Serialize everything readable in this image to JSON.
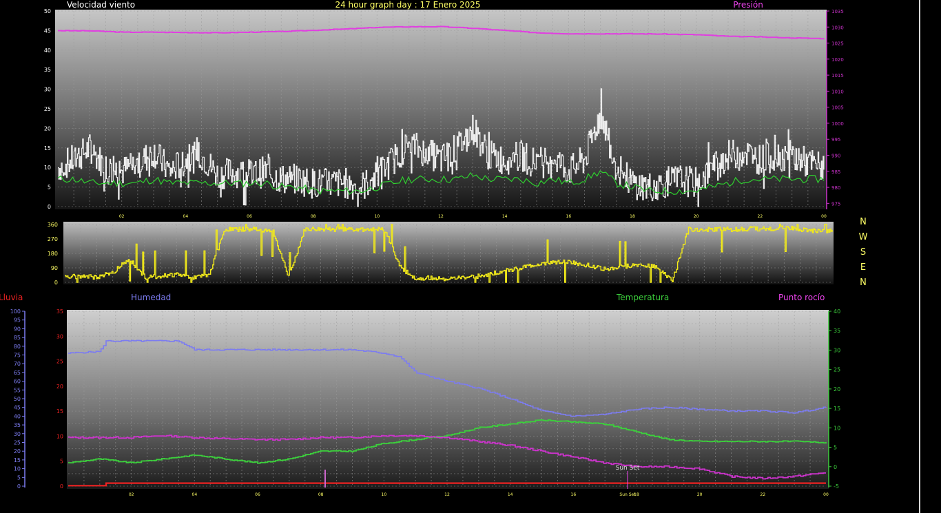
{
  "header": {
    "wind_title": "Velocidad viento",
    "graph_title": "24 hour graph day : 17 Enero 2025",
    "pressure_title": "Presión"
  },
  "compass": [
    "N",
    "W",
    "S",
    "E",
    "N"
  ],
  "legend": {
    "rain": "Lluvia",
    "humidity": "Humedad",
    "temperature": "Temperatura",
    "dewpoint": "Punto rocío"
  },
  "annotations": {
    "sunset": "Sun Set",
    "sunset_tick": "Sun Set"
  },
  "colors": {
    "wind_gust": "#ededed",
    "wind_avg": "#cfe8cf",
    "wind_green": "#2fcf2f",
    "pressure": "#e040e0",
    "direction": "#f2ea1a",
    "humidity": "#7c7cf0",
    "temperature": "#3ccf3c",
    "dewpoint": "#cc33cc",
    "rain": "#ee2222",
    "wind_axis": "#ffffff",
    "pressure_axis": "#cc33cc",
    "tick_label": "#ffff66"
  },
  "chart_data": [
    {
      "type": "line",
      "panel": "wind_pressure",
      "x_ticks": [
        "02",
        "04",
        "06",
        "08",
        "10",
        "12",
        "14",
        "16",
        "18",
        "20",
        "22",
        "00"
      ],
      "y_left": {
        "ticks": [
          0,
          5,
          10,
          15,
          20,
          25,
          30,
          35,
          40,
          45,
          50
        ],
        "ylim": [
          0,
          50
        ]
      },
      "y_right": {
        "ticks": [
          975,
          980,
          985,
          990,
          995,
          1000,
          1005,
          1010,
          1015,
          1020,
          1025,
          1030,
          1035
        ],
        "ylim": [
          974,
          1035
        ]
      },
      "grid": true,
      "series": [
        {
          "key": "gust",
          "hours": [
            0,
            0.5,
            1,
            1.5,
            2,
            2.5,
            3,
            3.5,
            4,
            4.5,
            5,
            5.5,
            6,
            6.5,
            7,
            7.5,
            8,
            8.5,
            9,
            9.5,
            10,
            10.5,
            11,
            11.5,
            12,
            12.5,
            13,
            13.5,
            14,
            14.5,
            15,
            15.5,
            16,
            16.5,
            17,
            17.5,
            18,
            18.5,
            19,
            19.5,
            20,
            20.5,
            21,
            21.5,
            22,
            22.5,
            23,
            23.5,
            24
          ],
          "values": [
            10,
            12,
            15,
            10,
            9,
            11,
            14,
            9,
            12,
            13,
            8,
            9,
            8,
            9,
            7,
            7,
            6,
            6,
            6,
            5,
            8,
            12,
            16,
            14,
            12,
            15,
            20,
            13,
            12,
            13,
            11,
            13,
            9,
            12,
            24,
            10,
            6,
            5,
            6,
            7,
            6,
            10,
            13,
            14,
            12,
            13,
            13,
            11,
            10
          ]
        },
        {
          "key": "avg",
          "hours": [
            0,
            0.5,
            1,
            1.5,
            2,
            2.5,
            3,
            3.5,
            4,
            4.5,
            5,
            5.5,
            6,
            6.5,
            7,
            7.5,
            8,
            8.5,
            9,
            9.5,
            10,
            10.5,
            11,
            11.5,
            12,
            12.5,
            13,
            13.5,
            14,
            14.5,
            15,
            15.5,
            16,
            16.5,
            17,
            17.5,
            18,
            18.5,
            19,
            19.5,
            20,
            20.5,
            21,
            21.5,
            22,
            22.5,
            23,
            23.5,
            24
          ],
          "values": [
            7,
            7,
            6,
            6,
            6,
            6,
            7,
            6,
            6,
            6,
            6,
            6,
            6,
            6,
            5,
            5,
            4,
            4,
            4,
            4,
            5,
            6,
            7,
            7,
            7,
            7,
            8,
            7,
            7,
            7,
            6,
            7,
            6,
            7,
            9,
            6,
            5,
            4,
            4,
            4,
            4,
            5,
            6,
            7,
            7,
            7,
            7,
            7,
            7
          ]
        },
        {
          "key": "pressure",
          "hours": [
            0,
            1,
            2,
            3,
            4,
            5,
            6,
            7,
            8,
            9,
            10,
            11,
            12,
            13,
            14,
            15,
            16,
            17,
            18,
            19,
            20,
            21,
            22,
            23,
            24
          ],
          "values": [
            1028.9,
            1028.8,
            1028.4,
            1028.4,
            1028.3,
            1028.2,
            1028.4,
            1028.6,
            1029,
            1029.4,
            1029.9,
            1030.1,
            1030.1,
            1029.6,
            1028.9,
            1028.2,
            1027.9,
            1027.9,
            1027.9,
            1027.8,
            1027.6,
            1027.1,
            1026.9,
            1026.6,
            1026.4
          ]
        }
      ]
    },
    {
      "type": "line",
      "panel": "wind_direction",
      "y": {
        "ticks": [
          0,
          90,
          180,
          270,
          360
        ],
        "ylim": [
          0,
          360
        ]
      },
      "series": [
        {
          "key": "direction",
          "hours": [
            0,
            0.5,
            1,
            1.5,
            2,
            2.5,
            3,
            3.5,
            4,
            4.5,
            5,
            5.5,
            6,
            6.5,
            7,
            7.5,
            8,
            8.5,
            9,
            9.5,
            10,
            10.5,
            11,
            11.5,
            12,
            12.5,
            13,
            13.5,
            14,
            14.5,
            15,
            15.5,
            16,
            16.5,
            17,
            17.5,
            18,
            18.5,
            19,
            19.5,
            20,
            20.5,
            21,
            21.5,
            22,
            22.5,
            23,
            23.5,
            24
          ],
          "values": [
            30,
            40,
            30,
            60,
            150,
            30,
            40,
            50,
            30,
            40,
            330,
            330,
            330,
            320,
            30,
            330,
            330,
            330,
            330,
            330,
            330,
            90,
            20,
            30,
            20,
            30,
            40,
            60,
            80,
            100,
            120,
            130,
            120,
            100,
            80,
            100,
            110,
            100,
            10,
            330,
            330,
            330,
            330,
            335,
            330,
            340,
            330,
            320,
            320
          ]
        }
      ]
    },
    {
      "type": "line",
      "panel": "temp_humidity",
      "x_ticks": [
        "02",
        "04",
        "06",
        "08",
        "10",
        "12",
        "14",
        "16",
        "18",
        "20",
        "22",
        "00"
      ],
      "y_left": {
        "ticks": [
          0,
          5,
          10,
          15,
          20,
          25,
          30,
          35
        ],
        "ylim": [
          0,
          35
        ]
      },
      "y_right": {
        "ticks": [
          -5,
          0,
          5,
          10,
          15,
          20,
          25,
          30,
          35,
          40
        ],
        "ylim": [
          -5,
          40
        ]
      },
      "y_outer": {
        "ticks": [
          0,
          5,
          10,
          15,
          20,
          25,
          30,
          35,
          40,
          45,
          50,
          55,
          60,
          65,
          70,
          75,
          80,
          85,
          90,
          95,
          100
        ],
        "ylim": [
          0,
          100
        ]
      },
      "grid": true,
      "series": [
        {
          "key": "humidity",
          "hours": [
            0,
            1,
            1.2,
            2,
            3,
            3.5,
            4,
            5,
            6,
            7,
            8,
            9,
            10,
            10.5,
            11,
            12,
            13,
            14,
            15,
            16,
            17,
            18,
            19,
            20,
            21,
            22,
            23,
            24
          ],
          "values": [
            76,
            77,
            83,
            83,
            83,
            83,
            78,
            78,
            78,
            78,
            78,
            78,
            76,
            74,
            65,
            60,
            56,
            50,
            43,
            40,
            41,
            44,
            45,
            44,
            43,
            43,
            42,
            45
          ]
        },
        {
          "key": "temperature",
          "hours": [
            0,
            1,
            2,
            3,
            4,
            5,
            6,
            7,
            8,
            9,
            10,
            11,
            12,
            13,
            14,
            15,
            16,
            17,
            18,
            19,
            20,
            21,
            22,
            23,
            24
          ],
          "values": [
            1,
            2,
            1,
            2,
            3,
            2,
            1,
            2,
            4,
            4,
            6,
            7,
            8,
            10,
            11,
            12,
            11.5,
            11,
            9,
            7,
            6.5,
            6.5,
            6.5,
            6.5,
            6.2
          ]
        },
        {
          "key": "dewpoint",
          "hours": [
            0,
            1,
            2,
            3,
            4,
            5,
            6,
            7,
            8,
            9,
            10,
            11,
            12,
            13,
            14,
            15,
            16,
            17,
            18,
            19,
            20,
            21,
            22,
            23,
            24
          ],
          "values": [
            7.5,
            7.5,
            7.5,
            8,
            7.5,
            7.2,
            7,
            7,
            7.5,
            7.5,
            8,
            8,
            7.5,
            6.5,
            5.5,
            4,
            2.5,
            1,
            0,
            0,
            -0.5,
            -2.5,
            -3,
            -2.5,
            -1.5
          ]
        },
        {
          "key": "rain",
          "hours": [
            0,
            1,
            1.2,
            24
          ],
          "values": [
            0.1,
            0.1,
            0.6,
            0.6
          ]
        }
      ]
    }
  ]
}
